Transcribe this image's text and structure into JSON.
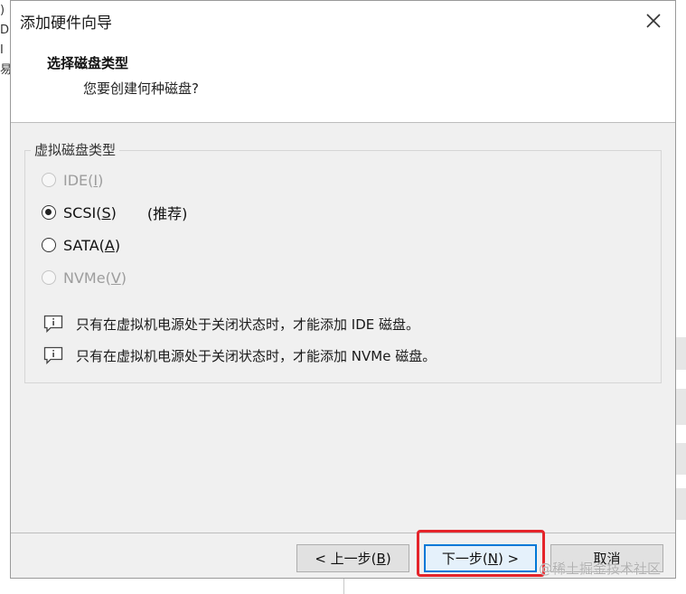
{
  "window": {
    "title": "添加硬件向导"
  },
  "header": {
    "title": "选择磁盘类型",
    "subtitle": "您要创建何种磁盘?"
  },
  "group": {
    "label": "虚拟磁盘类型",
    "options": [
      {
        "pre": "IDE(",
        "key": "I",
        "post": ")",
        "selected": false,
        "enabled": false
      },
      {
        "pre": "SCSI(",
        "key": "S",
        "post": ")",
        "selected": true,
        "enabled": true,
        "note": "(推荐)"
      },
      {
        "pre": "SATA(",
        "key": "A",
        "post": ")",
        "selected": false,
        "enabled": true
      },
      {
        "pre": "NVMe(",
        "key": "V",
        "post": ")",
        "selected": false,
        "enabled": false
      }
    ],
    "infos": [
      "只有在虚拟机电源处于关闭状态时，才能添加 IDE 磁盘。",
      "只有在虚拟机电源处于关闭状态时，才能添加 NVMe 磁盘。"
    ]
  },
  "buttons": {
    "back": {
      "pre": "< 上一步(",
      "key": "B",
      "post": ")"
    },
    "next": {
      "pre": "下一步(",
      "key": "N",
      "post": ") >"
    },
    "cancel": {
      "label": "取消"
    }
  },
  "watermark": "@稀土掘金技术社区",
  "colors": {
    "dialog_bg": "#f0f0f0",
    "accent": "#0078d7",
    "highlight": "#e5242a"
  }
}
